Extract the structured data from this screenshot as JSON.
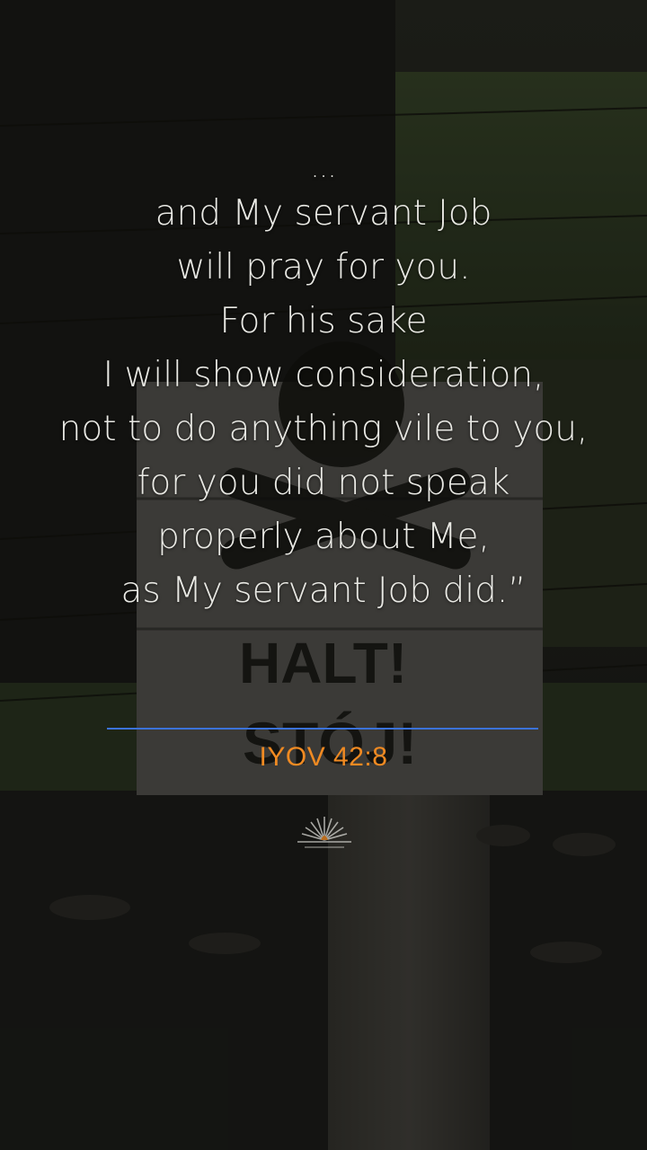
{
  "verse": {
    "lines": [
      "...",
      "and My servant Job",
      "will pray for you.",
      "For his sake",
      "I will show consideration,",
      "not to do anything vile to you,",
      "for you did not speak",
      "properly about Me,",
      "as My servant Job did.”"
    ]
  },
  "reference": "IYOV 42:8",
  "colors": {
    "reference": "#f08a22",
    "divider": "#3b72d9",
    "verse_text": "#e9e9e4"
  },
  "icons": {
    "logo": "sunrise-logo-icon"
  }
}
